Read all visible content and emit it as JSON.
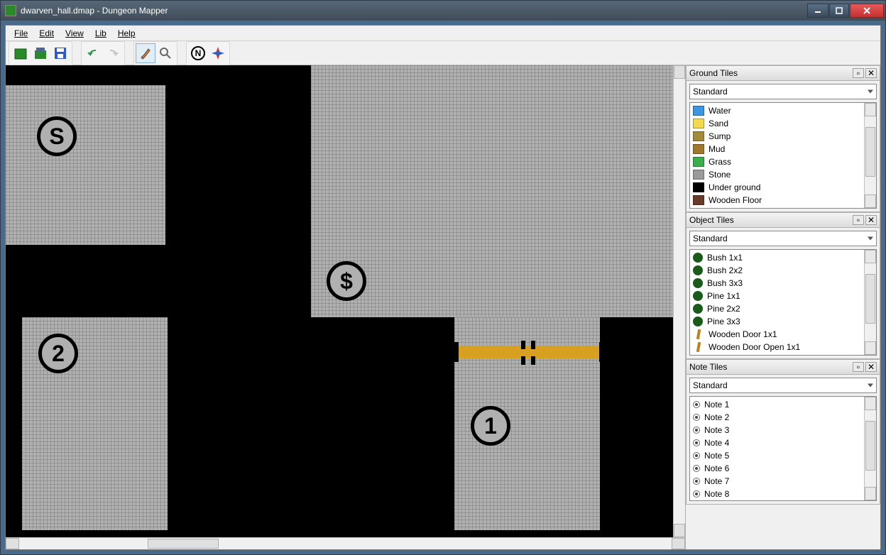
{
  "title": "dwarven_hall.dmap - Dungeon Mapper",
  "menu": {
    "file": "File",
    "edit": "Edit",
    "view": "View",
    "lib": "Lib",
    "help": "Help"
  },
  "toolbar": {
    "new": "new-map",
    "open": "open-map",
    "save": "save-map",
    "undo": "undo",
    "redo": "redo",
    "brush": "brush-tool",
    "picker": "picker-tool",
    "north": "north-toggle",
    "compass": "compass-toggle"
  },
  "map": {
    "markers": [
      {
        "id": "S",
        "label": "S"
      },
      {
        "id": "dollar",
        "label": "$"
      },
      {
        "id": "two",
        "label": "2"
      },
      {
        "id": "one",
        "label": "1"
      }
    ]
  },
  "panels": {
    "ground": {
      "title": "Ground Tiles",
      "set": "Standard",
      "items": [
        {
          "label": "Water",
          "color": "#3a96e0"
        },
        {
          "label": "Sand",
          "color": "#f2d94e"
        },
        {
          "label": "Sump",
          "color": "#a28a3a"
        },
        {
          "label": "Mud",
          "color": "#a0782a"
        },
        {
          "label": "Grass",
          "color": "#3aae4a"
        },
        {
          "label": "Stone",
          "color": "#9a9a9a"
        },
        {
          "label": "Under ground",
          "color": "#000000"
        },
        {
          "label": "Wooden Floor",
          "color": "#6a3a28"
        }
      ]
    },
    "object": {
      "title": "Object Tiles",
      "set": "Standard",
      "items": [
        {
          "label": "Bush 1x1",
          "kind": "bush"
        },
        {
          "label": "Bush 2x2",
          "kind": "bush"
        },
        {
          "label": "Bush 3x3",
          "kind": "bush"
        },
        {
          "label": "Pine 1x1",
          "kind": "bush"
        },
        {
          "label": "Pine 2x2",
          "kind": "bush"
        },
        {
          "label": "Pine 3x3",
          "kind": "bush"
        },
        {
          "label": "Wooden Door 1x1",
          "kind": "door"
        },
        {
          "label": "Wooden Door Open 1x1",
          "kind": "door"
        }
      ]
    },
    "note": {
      "title": "Note Tiles",
      "set": "Standard",
      "items": [
        {
          "label": "Note 1"
        },
        {
          "label": "Note 2"
        },
        {
          "label": "Note 3"
        },
        {
          "label": "Note 4"
        },
        {
          "label": "Note 5"
        },
        {
          "label": "Note 6"
        },
        {
          "label": "Note 7"
        },
        {
          "label": "Note 8"
        }
      ]
    }
  }
}
